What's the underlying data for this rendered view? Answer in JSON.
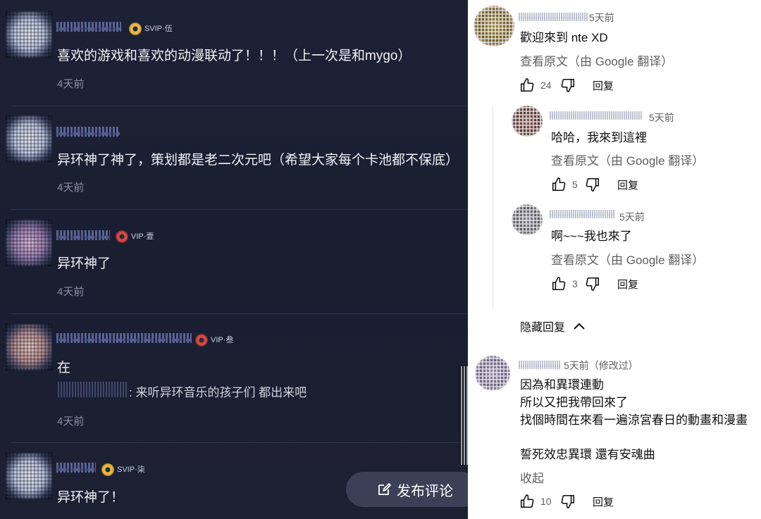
{
  "left": {
    "comments": [
      {
        "badge": "SVIP·伍",
        "badge_kind": "gold",
        "text": "喜欢的游戏和喜欢的动漫联动了！！！（上一次是和mygo）",
        "time": "4天前"
      },
      {
        "badge": "",
        "badge_kind": "",
        "text": "异环神了神了，策划都是老二次元吧（希望大家每个卡池都不保底）",
        "time": "4天前"
      },
      {
        "badge": "VIP·壹",
        "badge_kind": "red",
        "text": "异环神了",
        "time": "4天前"
      },
      {
        "badge": "VIP·叁",
        "badge_kind": "red",
        "text": "在",
        "time": "4天前",
        "reply_text": ": 来听异环音乐的孩子们 都出来吧"
      },
      {
        "badge": "SVIP·柒",
        "badge_kind": "gold",
        "text": "异环神了！",
        "time": ""
      }
    ],
    "post_button_label": "发布评论"
  },
  "right": {
    "main_comment": {
      "time": "5天前",
      "text": "歡迎來到 nte XD",
      "translate": "查看原文（由 Google 翻译）",
      "likes": "24",
      "reply_label": "回复"
    },
    "replies": [
      {
        "time": "5天前",
        "text": "哈哈，我來到這裡",
        "translate": "查看原文（由 Google 翻译）",
        "likes": "5",
        "reply_label": "回复"
      },
      {
        "time": "5天前",
        "text": "啊~~~我也來了",
        "translate": "查看原文（由 Google 翻译）",
        "likes": "3",
        "reply_label": "回复"
      }
    ],
    "hide_replies_label": "隐藏回复",
    "second_comment": {
      "time": "5天前（修改过）",
      "lines": [
        "因為和異環連動",
        "所以又把我帶回來了",
        "找個時間在來看一遍涼宮春日的動畫和漫畫",
        "",
        "誓死效忠異環 還有安魂曲"
      ],
      "collapse_label": "收起",
      "likes": "10",
      "reply_label": "回复"
    }
  },
  "colors": {
    "left_bg": "#1d2135",
    "right_bg": "#ffffff",
    "gold_badge": "#e6b94a",
    "red_badge": "#d44a4a"
  }
}
